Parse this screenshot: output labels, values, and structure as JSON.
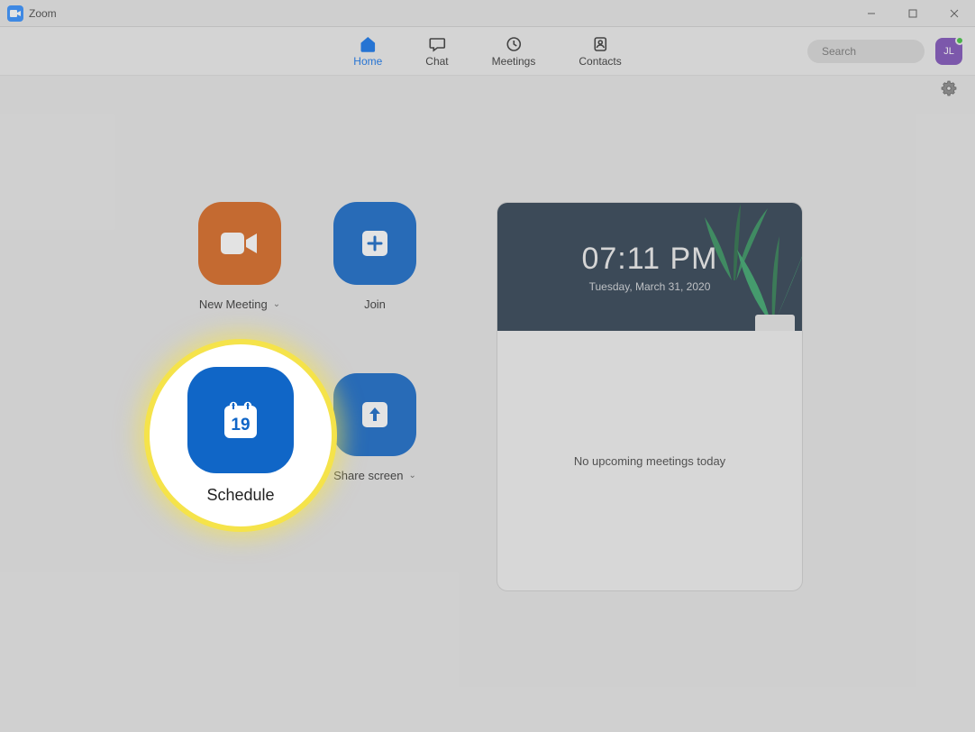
{
  "window": {
    "title": "Zoom"
  },
  "nav": {
    "tabs": [
      {
        "label": "Home"
      },
      {
        "label": "Chat"
      },
      {
        "label": "Meetings"
      },
      {
        "label": "Contacts"
      }
    ],
    "active_index": 0
  },
  "search": {
    "placeholder": "Search",
    "value": ""
  },
  "user": {
    "initials": "JL"
  },
  "actions": {
    "new_meeting": {
      "label": "New Meeting",
      "has_dropdown": true
    },
    "join": {
      "label": "Join",
      "has_dropdown": false
    },
    "schedule": {
      "label": "Schedule",
      "has_dropdown": false,
      "calendar_day": "19"
    },
    "share_screen": {
      "label": "Share screen",
      "has_dropdown": true
    }
  },
  "panel": {
    "time": "07:11 PM",
    "date": "Tuesday, March 31, 2020",
    "empty_message": "No upcoming meetings today"
  }
}
